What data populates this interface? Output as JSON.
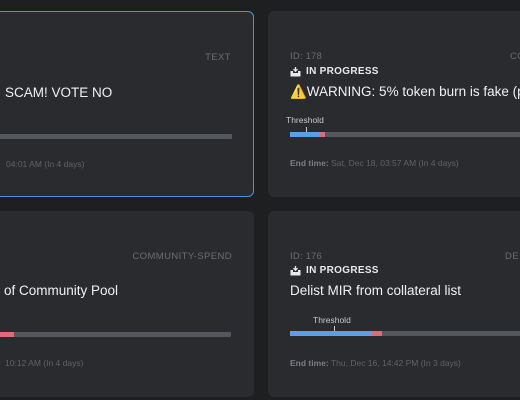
{
  "cards": [
    {
      "type": "TEXT",
      "title": "SCAM! VOTE NO",
      "end_time_value": "04:01 AM (In 4 days)"
    },
    {
      "id": "ID: 178",
      "type": "CO",
      "status": "IN PROGRESS",
      "title": "⚠️WARNING: 5% token burn is fake (p",
      "threshold_label": "Threshold",
      "yes_ratio": 0.12,
      "no_ratio": 0.02,
      "end_time_label": "End time:",
      "end_time_value": "Sat, Dec 18, 03:57 AM (In 4 days)"
    },
    {
      "type": "COMMUNITY-SPEND",
      "title": "of Community Pool",
      "yes_ratio": 0.0,
      "no_ratio": 0.1,
      "end_time_value": "10:12 AM (In 4 days)"
    },
    {
      "id": "ID: 176",
      "type": "DE",
      "status": "IN PROGRESS",
      "title": "Delist MIR from collateral list",
      "threshold_label": "Threshold",
      "yes_ratio": 0.33,
      "no_ratio": 0.04,
      "end_time_label": "End time:",
      "end_time_value": "Thu, Dec 16, 14:42 PM (In 3 days)"
    }
  ],
  "colors": {
    "yes": "#5aa0e8",
    "no": "#e2697a",
    "track": "#54575c",
    "selected_border": "#4f8fd6"
  },
  "icons": {
    "status": "inbox-tray-icon",
    "warning": "warning-icon"
  }
}
